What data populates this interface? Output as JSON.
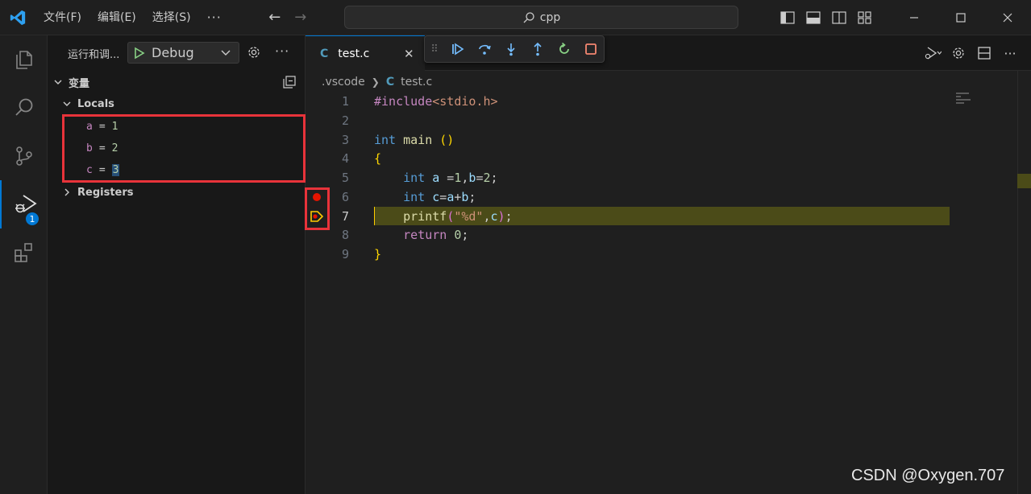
{
  "titlebar": {
    "menu": [
      "文件(F)",
      "编辑(E)",
      "选择(S)"
    ],
    "more": "···",
    "search_text": "cpp"
  },
  "activitybar": {
    "items": [
      "explorer-icon",
      "search-icon",
      "source-control-icon",
      "run-debug-icon",
      "extensions-icon"
    ],
    "debug_badge": "1"
  },
  "sidebar": {
    "title": "运行和调...",
    "config_label": "Debug",
    "more": "···",
    "variables_header": "变量",
    "locals_header": "Locals",
    "registers_header": "Registers",
    "locals": [
      {
        "name": "a",
        "value": "1"
      },
      {
        "name": "b",
        "value": "2"
      },
      {
        "name": "c",
        "value": "3"
      }
    ]
  },
  "editor": {
    "tab_icon": "C",
    "tab_name": "test.c",
    "tab_close": "✕",
    "breadcrumb": [
      ".vscode",
      "test.c"
    ],
    "line_numbers": [
      "1",
      "2",
      "3",
      "4",
      "5",
      "6",
      "7",
      "8",
      "9"
    ],
    "current_line": 7,
    "breakpoint_line": 6
  },
  "watermark": "CSDN @Oxygen.707",
  "colors": {
    "accent": "#0078d4",
    "breakpoint": "#e51400",
    "annotation_box": "#e8333a",
    "current_line_bg": "#4b4b18"
  }
}
